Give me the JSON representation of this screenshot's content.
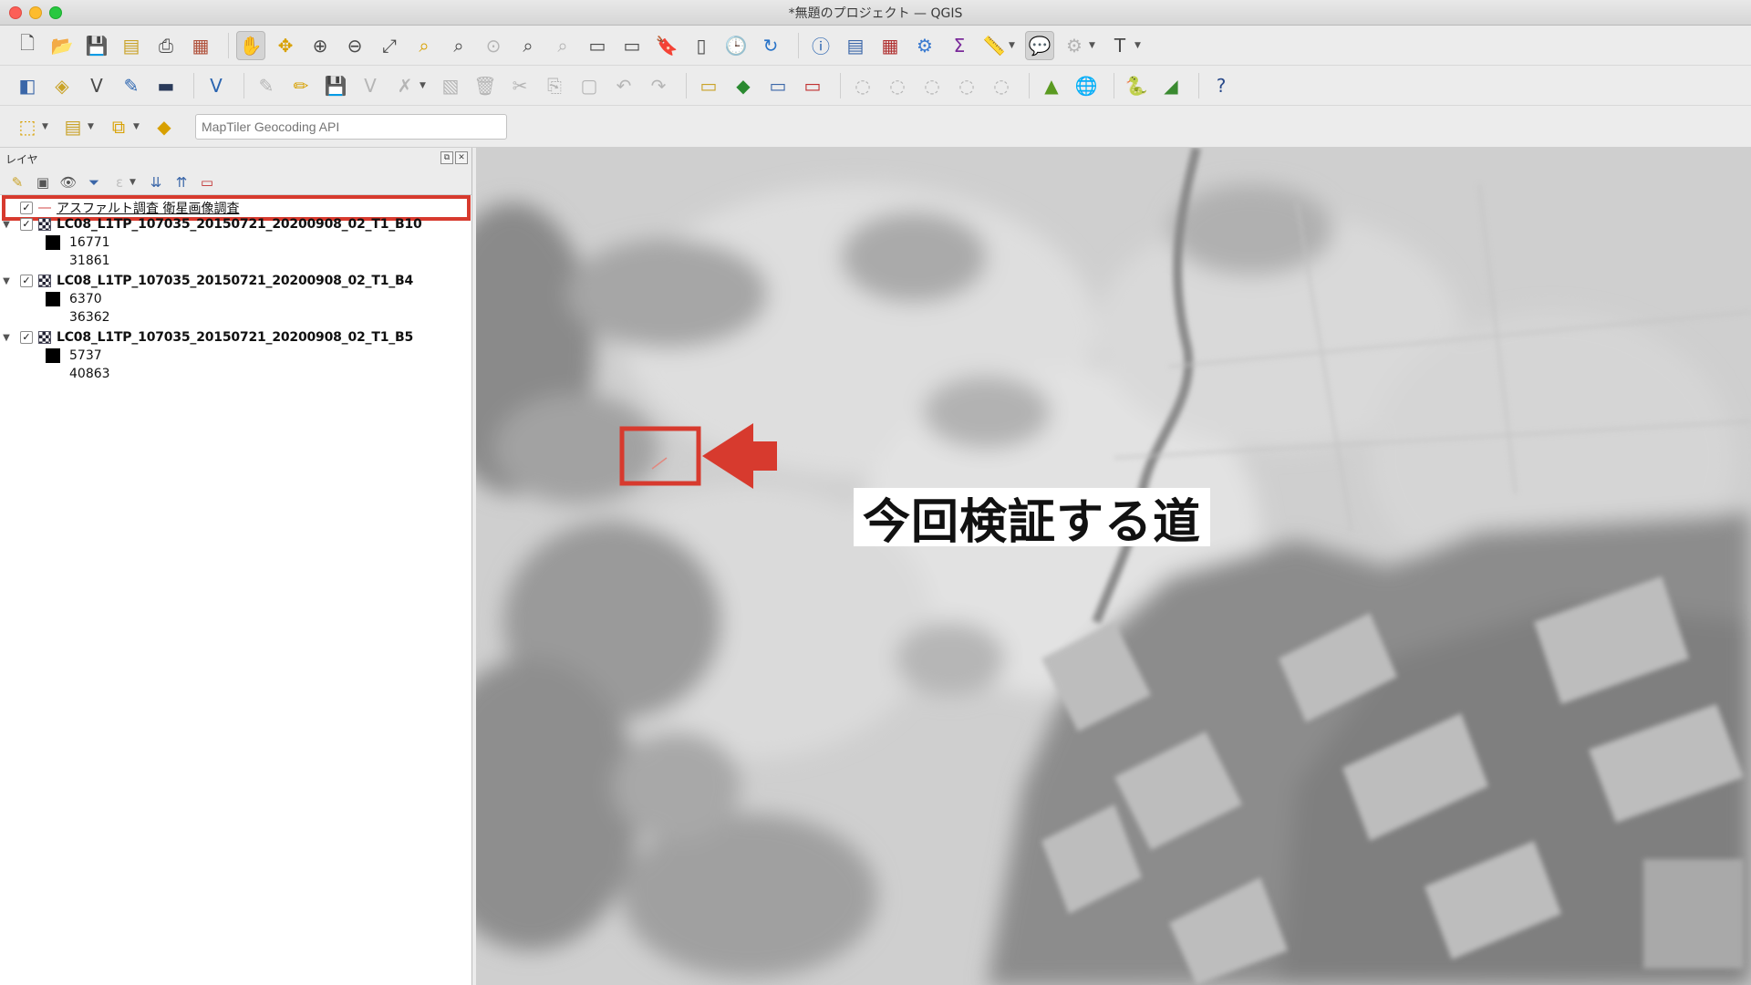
{
  "window": {
    "title": "*無題のプロジェクト — QGIS"
  },
  "toolbar1": {
    "icons": [
      "new-project-icon",
      "open-project-icon",
      "save-project-icon",
      "save-as-icon",
      "print-layout-icon",
      "style-manager-icon",
      "pan-icon",
      "pan-to-selection-icon",
      "zoom-in-icon",
      "zoom-out-icon",
      "zoom-full-icon",
      "zoom-to-selection-icon",
      "zoom-to-layer-icon",
      "zoom-native-icon",
      "zoom-last-icon",
      "zoom-next-icon",
      "new-bookmark-icon",
      "show-bookmarks-icon",
      "new-map-view-icon",
      "spatial-bookmark-icon",
      "temporal-icon",
      "refresh-icon",
      "identify-icon",
      "attribute-table-icon",
      "field-calculator-icon",
      "processing-toolbox-icon",
      "statistics-icon",
      "measure-icon",
      "map-tips-icon",
      "annotation-icon",
      "text-annotation-icon"
    ]
  },
  "toolbar3": {
    "geocoder_placeholder": "MapTiler Geocoding API"
  },
  "layers_panel": {
    "title": "レイヤ",
    "layers": [
      {
        "name": "アスファルト調査 衛星画像調査",
        "checked": true,
        "type": "vector-line"
      },
      {
        "name": "LC08_L1TP_107035_20150721_20200908_02_T1_B10",
        "checked": true,
        "type": "raster",
        "min": "16771",
        "max": "31861"
      },
      {
        "name": "LC08_L1TP_107035_20150721_20200908_02_T1_B4",
        "checked": true,
        "type": "raster",
        "min": "6370",
        "max": "36362"
      },
      {
        "name": "LC08_L1TP_107035_20150721_20200908_02_T1_B5",
        "checked": true,
        "type": "raster",
        "min": "5737",
        "max": "40863"
      }
    ]
  },
  "map": {
    "callout_text": "今回検証する道",
    "highlight_color": "#d73a2e"
  }
}
